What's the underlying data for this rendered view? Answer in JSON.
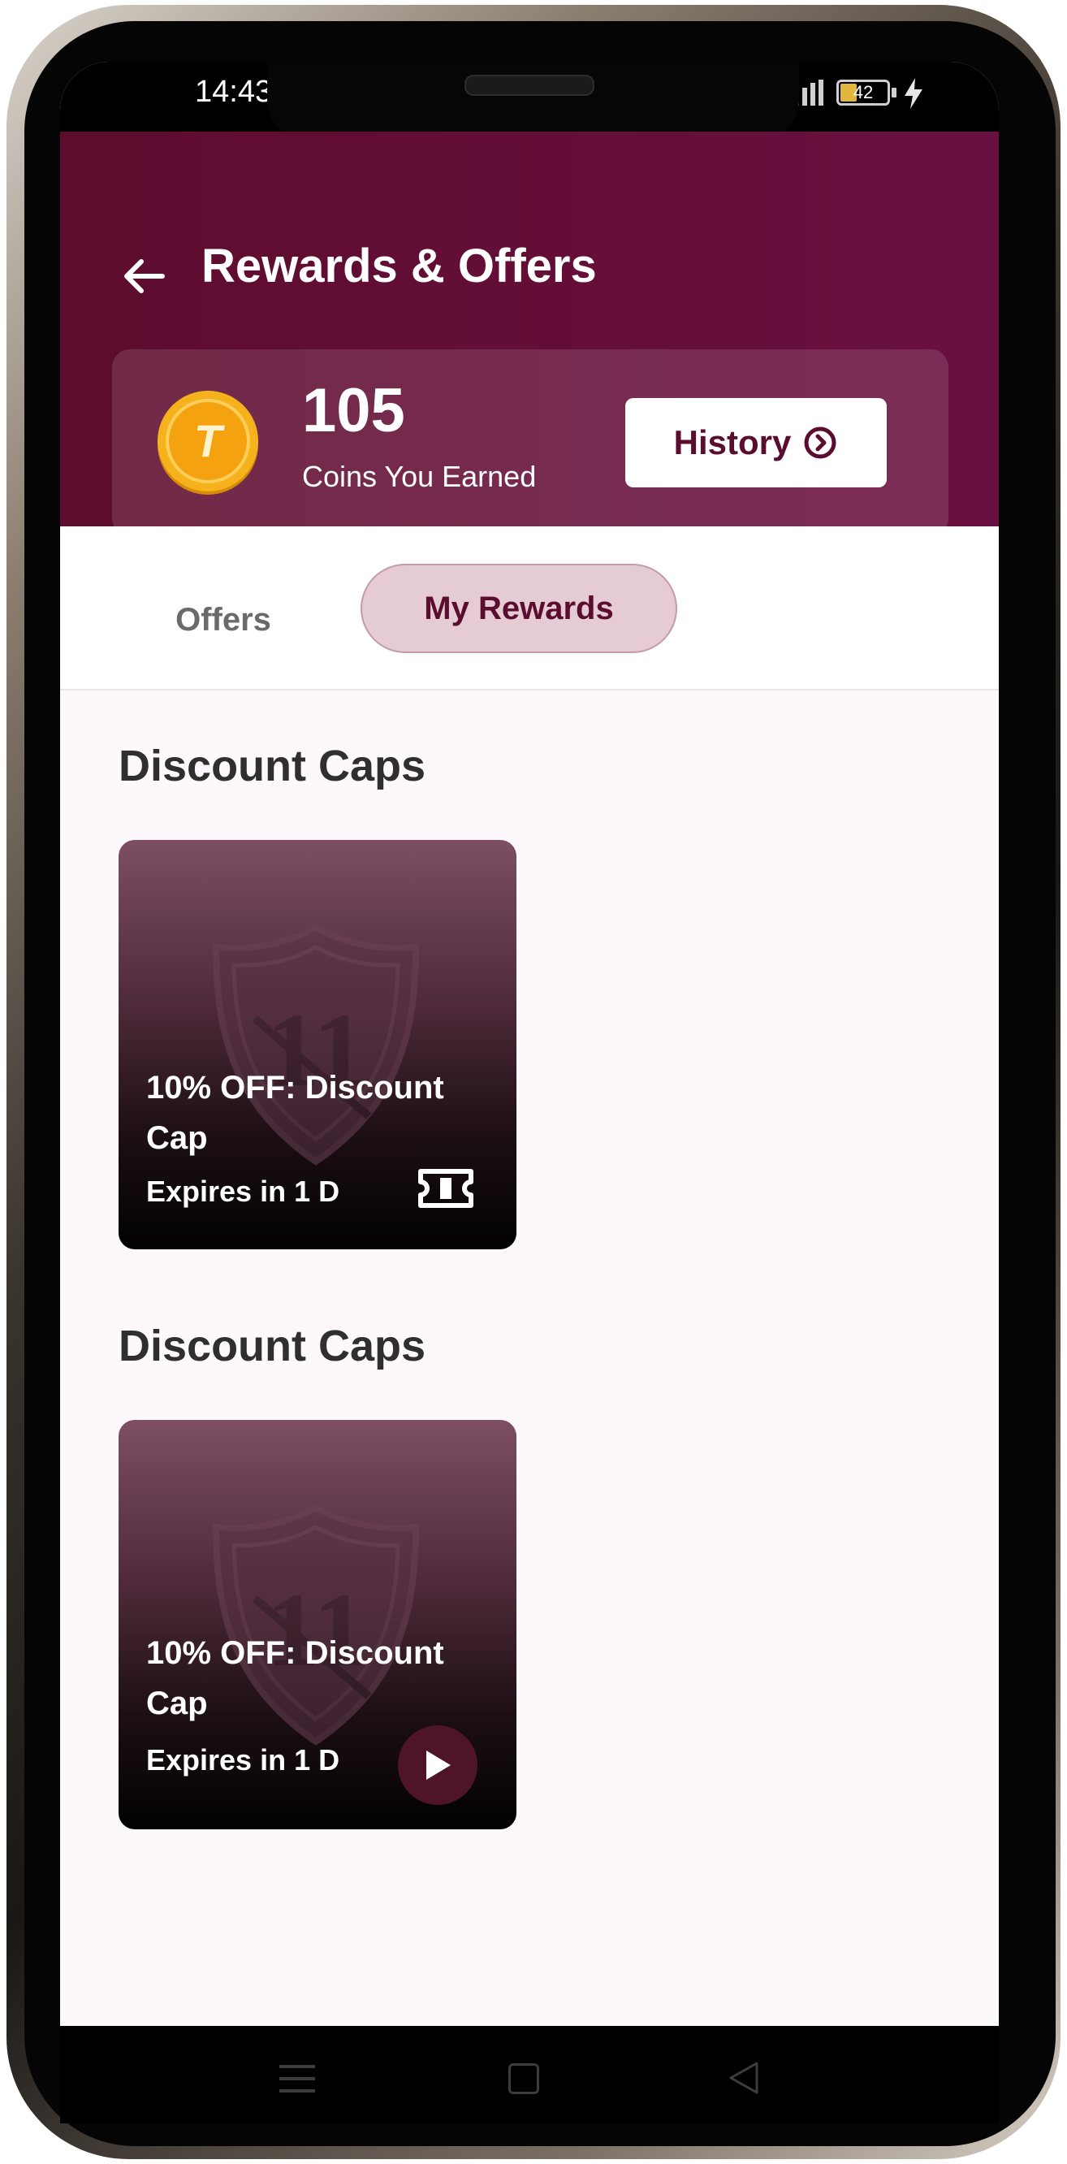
{
  "status_bar": {
    "time": "14:43",
    "battery": "42"
  },
  "header": {
    "title": "Rewards & Offers"
  },
  "coins": {
    "value": "105",
    "label": "Coins You Earned",
    "icon_letter": "T"
  },
  "history_button": {
    "label": "History"
  },
  "tabs": [
    {
      "label": "Offers",
      "active": false
    },
    {
      "label": "My Rewards",
      "active": true
    }
  ],
  "sections": [
    {
      "title": "Discount Caps",
      "card": {
        "title": "10% OFF: Discount Cap",
        "expiry": "Expires in 1 D",
        "action_icon": "ticket-icon"
      }
    },
    {
      "title": "Discount Caps",
      "card": {
        "title": "10% OFF: Discount Cap",
        "expiry": "Expires in 1 D",
        "action_icon": "play-icon"
      }
    }
  ],
  "colors": {
    "brand": "#5d0c2d",
    "tab_active_bg": "#e5cbd4",
    "coin": "#f2a60d"
  }
}
